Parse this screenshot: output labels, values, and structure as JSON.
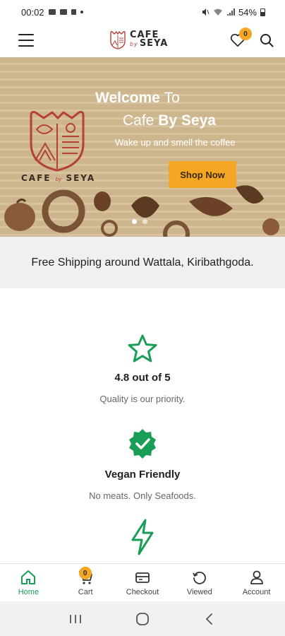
{
  "status_bar": {
    "time": "00:02",
    "battery": "54%"
  },
  "header": {
    "logo_top": "CAFE",
    "logo_by": "by",
    "logo_bottom": "SEYA",
    "wishlist_count": "0"
  },
  "hero": {
    "welcome_bold": "Welcome",
    "welcome_light": "To",
    "cafe_light": "Cafe",
    "cafe_bold": "By Seya",
    "tagline": "Wake up and smell the coffee",
    "cta": "Shop Now",
    "logo_left": "CAFE",
    "logo_by": "by",
    "logo_right": "SEYA"
  },
  "shipping_text": "Free Shipping around Wattala, Kiribathgoda.",
  "features": [
    {
      "icon": "star-icon",
      "title": "4.8 out of 5",
      "subtitle": "Quality is our priority."
    },
    {
      "icon": "verified-badge-icon",
      "title": "Vegan Friendly",
      "subtitle": "No meats. Only Seafoods."
    },
    {
      "icon": "lightning-icon",
      "title": "",
      "subtitle": ""
    }
  ],
  "bottom_nav": [
    {
      "label": "Home",
      "icon": "home-icon",
      "active": true
    },
    {
      "label": "Cart",
      "icon": "cart-icon",
      "badge": "0"
    },
    {
      "label": "Checkout",
      "icon": "wallet-icon"
    },
    {
      "label": "Viewed",
      "icon": "history-icon"
    },
    {
      "label": "Account",
      "icon": "user-icon"
    }
  ],
  "colors": {
    "accent": "#1a9e57",
    "cta": "#f5a623",
    "brand_red": "#b3403a"
  }
}
